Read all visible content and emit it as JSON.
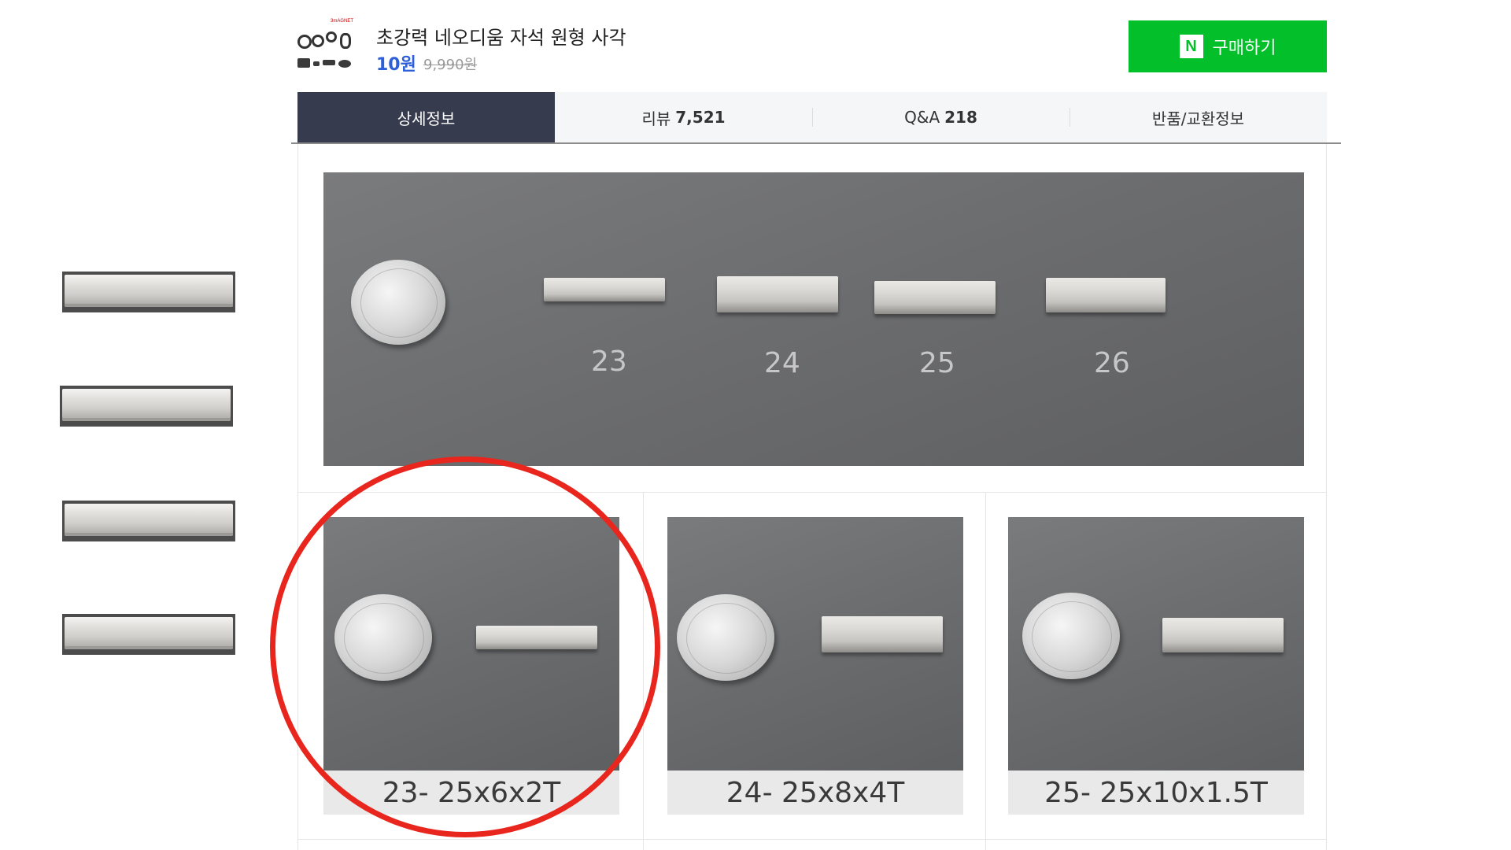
{
  "product": {
    "title": "초강력 네오디움 자석 원형 사각",
    "price": "10원",
    "original_price": "9,990원",
    "thumb_brand": "3mAGNET"
  },
  "buy_button": {
    "badge": "N",
    "label": "구매하기"
  },
  "tabs": [
    {
      "label": "상세정보",
      "count": ""
    },
    {
      "label": "리뷰",
      "count": "7,521"
    },
    {
      "label": "Q&A",
      "count": "218"
    },
    {
      "label": "반품/교환정보",
      "count": ""
    }
  ],
  "overview_photo": {
    "labels": [
      "23",
      "24",
      "25",
      "26"
    ]
  },
  "detail_photos": [
    {
      "caption": "23- 25x6x2T"
    },
    {
      "caption": "24- 25x8x4T"
    },
    {
      "caption": "25- 25x10x1.5T"
    }
  ],
  "colors": {
    "buy_green": "#03c02a",
    "active_tab": "#363b4e",
    "price_blue": "#2d5fd8",
    "highlight_circle": "#e8261d"
  }
}
